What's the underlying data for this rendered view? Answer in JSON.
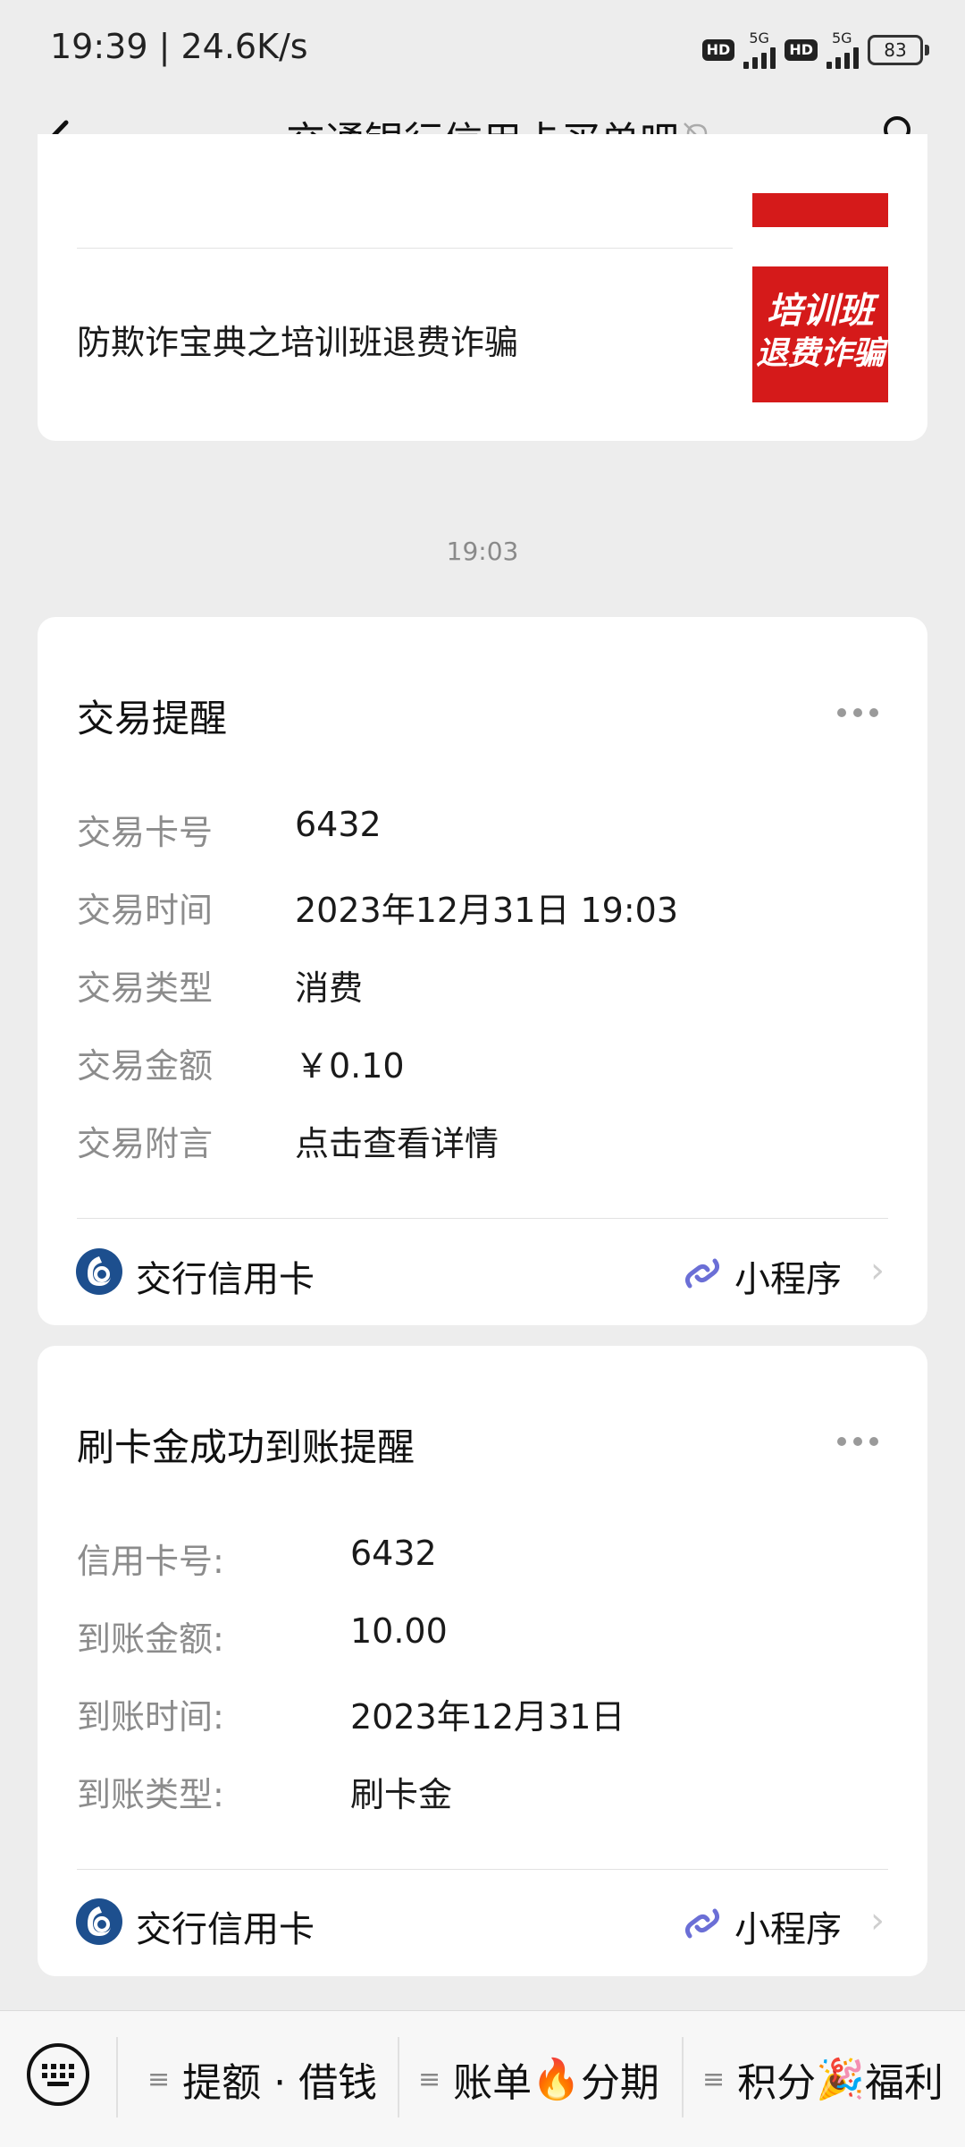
{
  "status_bar": {
    "time": "19:39 | 24.6K/s",
    "hd_label": "HD",
    "network_label": "5G",
    "battery": "83"
  },
  "nav": {
    "title": "交通银行信用卡买单吧"
  },
  "article": {
    "title": "防欺诈宝典之培训班退费诈骗",
    "thumb_line1": "培训班",
    "thumb_line2": "退费诈骗"
  },
  "timestamp": "19:03",
  "transaction_card": {
    "title": "交易提醒",
    "rows": [
      {
        "label": "交易卡号",
        "value": "6432"
      },
      {
        "label": "交易时间",
        "value": "2023年12月31日 19:03"
      },
      {
        "label": "交易类型",
        "value": "消费"
      },
      {
        "label": "交易金额",
        "value": "￥0.10"
      },
      {
        "label": "交易附言",
        "value": "点击查看详情"
      }
    ],
    "source": "交行信用卡",
    "mini_program": "小程序"
  },
  "deposit_card": {
    "title": "刷卡金成功到账提醒",
    "rows": [
      {
        "label": "信用卡号:",
        "value": "6432"
      },
      {
        "label": "到账金额:",
        "value": "10.00"
      },
      {
        "label": "到账时间:",
        "value": "2023年12月31日"
      },
      {
        "label": "到账类型:",
        "value": "刷卡金"
      }
    ],
    "source": "交行信用卡",
    "mini_program": "小程序"
  },
  "bottom_menu": {
    "items": [
      {
        "label": "提额 · 借钱"
      },
      {
        "label_a": "账单",
        "emoji": "🔥",
        "label_b": "分期"
      },
      {
        "label_a": "积分",
        "emoji": "🎉",
        "label_b": "福利"
      }
    ]
  },
  "colors": {
    "background": "#ededed",
    "card": "#ffffff",
    "label_gray": "#8c8c8c",
    "thumb_red": "#d51a1a",
    "bank_blue": "#1d4f8e",
    "mini_program_purple": "#6b6fd6"
  }
}
